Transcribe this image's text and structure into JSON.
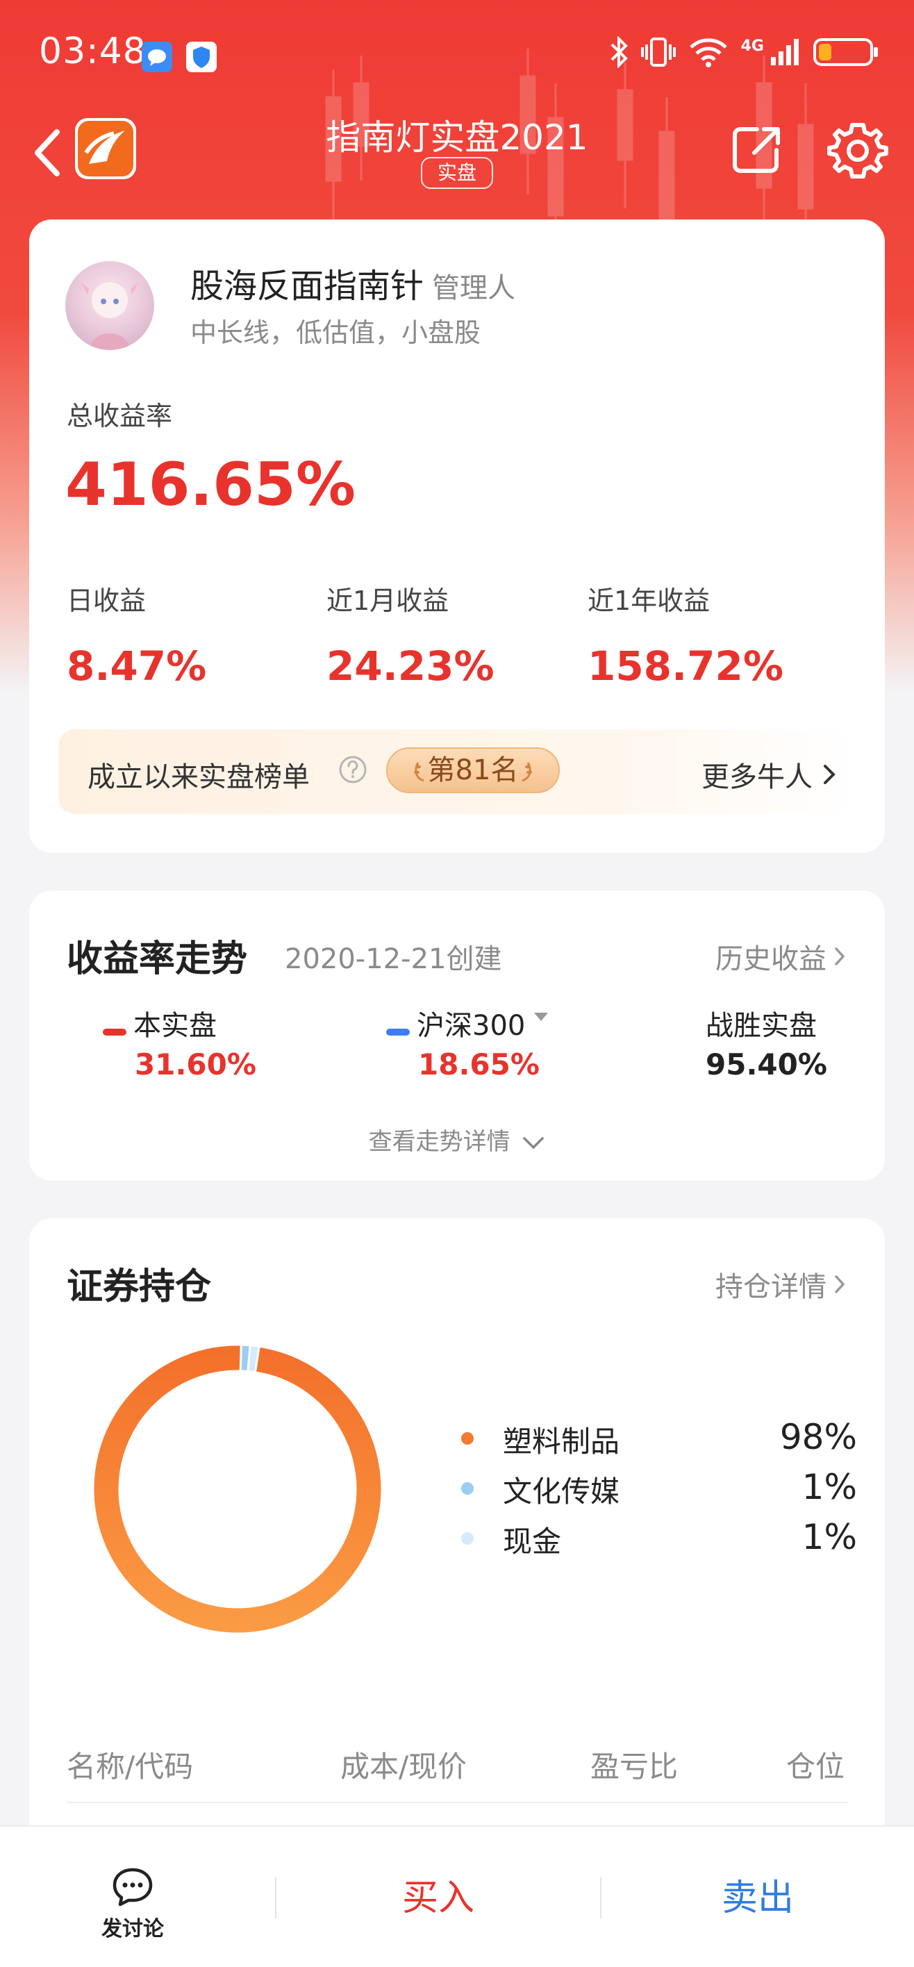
{
  "status_bar": {
    "time": "03:48",
    "network": "4G"
  },
  "nav": {
    "title": "指南灯实盘2021",
    "badge": "实盘"
  },
  "manager": {
    "name": "股海反面指南针",
    "role": "管理人",
    "style": "中长线，低估值，小盘股"
  },
  "returns": {
    "total_label": "总收益率",
    "total_value": "416.65%",
    "daily_label": "日收益",
    "daily_value": "8.47%",
    "month_label": "近1月收益",
    "month_value": "24.23%",
    "year_label": "近1年收益",
    "year_value": "158.72%"
  },
  "rank": {
    "label": "成立以来实盘榜单",
    "badge": "第81名",
    "more": "更多牛人"
  },
  "trend": {
    "title": "收益率走势",
    "created": "2020-12-21创建",
    "history_link": "历史收益",
    "series": [
      {
        "name": "本实盘",
        "value": "31.60%",
        "color": "#e8332c"
      },
      {
        "name": "沪深300",
        "value": "18.65%",
        "color": "#3d7ff0"
      },
      {
        "name": "战胜实盘",
        "value": "95.40%"
      }
    ],
    "detail_toggle": "查看走势详情"
  },
  "holdings": {
    "title": "证券持仓",
    "detail_link": "持仓详情",
    "table_headers": [
      "名称/代码",
      "成本/现价",
      "盈亏比",
      "仓位"
    ]
  },
  "chart_data": {
    "type": "pie",
    "categories": [
      "塑料制品",
      "文化传媒",
      "现金"
    ],
    "values": [
      98,
      1,
      1
    ],
    "labels": [
      "98%",
      "1%",
      "1%"
    ],
    "colors": [
      "#f57a30",
      "#9ccdf2",
      "#d4ebfb"
    ]
  },
  "bottom": {
    "discuss": "发讨论",
    "buy": "买入",
    "sell": "卖出"
  },
  "colors": {
    "brand_red": "#ef3b35",
    "gain_red": "#e8332c",
    "sell_blue": "#2f7de1"
  }
}
